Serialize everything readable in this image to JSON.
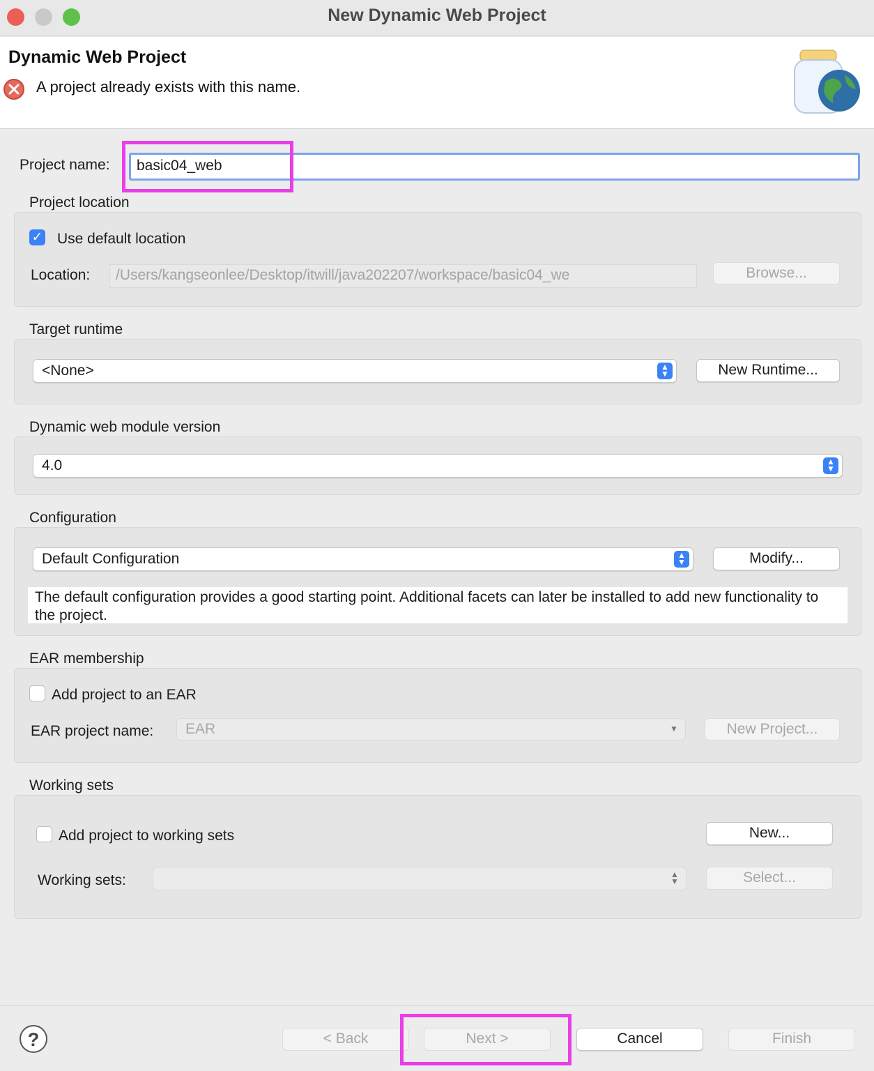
{
  "window": {
    "title": "New Dynamic Web Project"
  },
  "header": {
    "title": "Dynamic Web Project",
    "error_message": "A project already exists with this name."
  },
  "project_name": {
    "label": "Project name:",
    "value": "basic04_web"
  },
  "project_location": {
    "heading": "Project location",
    "use_default_label": "Use default location",
    "use_default_checked": true,
    "location_label": "Location:",
    "location_value": "/Users/kangseonlee/Desktop/itwill/java202207/workspace/basic04_we",
    "browse_label": "Browse..."
  },
  "target_runtime": {
    "heading": "Target runtime",
    "selected": "<None>",
    "new_runtime_label": "New Runtime..."
  },
  "web_module": {
    "heading": "Dynamic web module version",
    "selected": "4.0"
  },
  "configuration": {
    "heading": "Configuration",
    "selected": "Default Configuration",
    "modify_label": "Modify...",
    "description": "The default configuration provides a good starting point. Additional facets can later be installed to add new functionality to the project."
  },
  "ear": {
    "heading": "EAR membership",
    "add_label": "Add project to an EAR",
    "add_checked": false,
    "name_label": "EAR project name:",
    "name_value": "EAR",
    "new_project_label": "New Project..."
  },
  "working_sets": {
    "heading": "Working sets",
    "add_label": "Add project to working sets",
    "add_checked": false,
    "new_label": "New...",
    "sets_label": "Working sets:",
    "sets_value": "",
    "select_label": "Select..."
  },
  "footer": {
    "help_symbol": "?",
    "back_label": "< Back",
    "next_label": "Next >",
    "cancel_label": "Cancel",
    "finish_label": "Finish"
  },
  "colors": {
    "accent": "#3b82f6",
    "highlight": "#e83fe6",
    "error": "#e46a5e",
    "traffic_close": "#ec5f57",
    "traffic_min": "#c9c9c9",
    "traffic_max": "#5fc14a"
  }
}
